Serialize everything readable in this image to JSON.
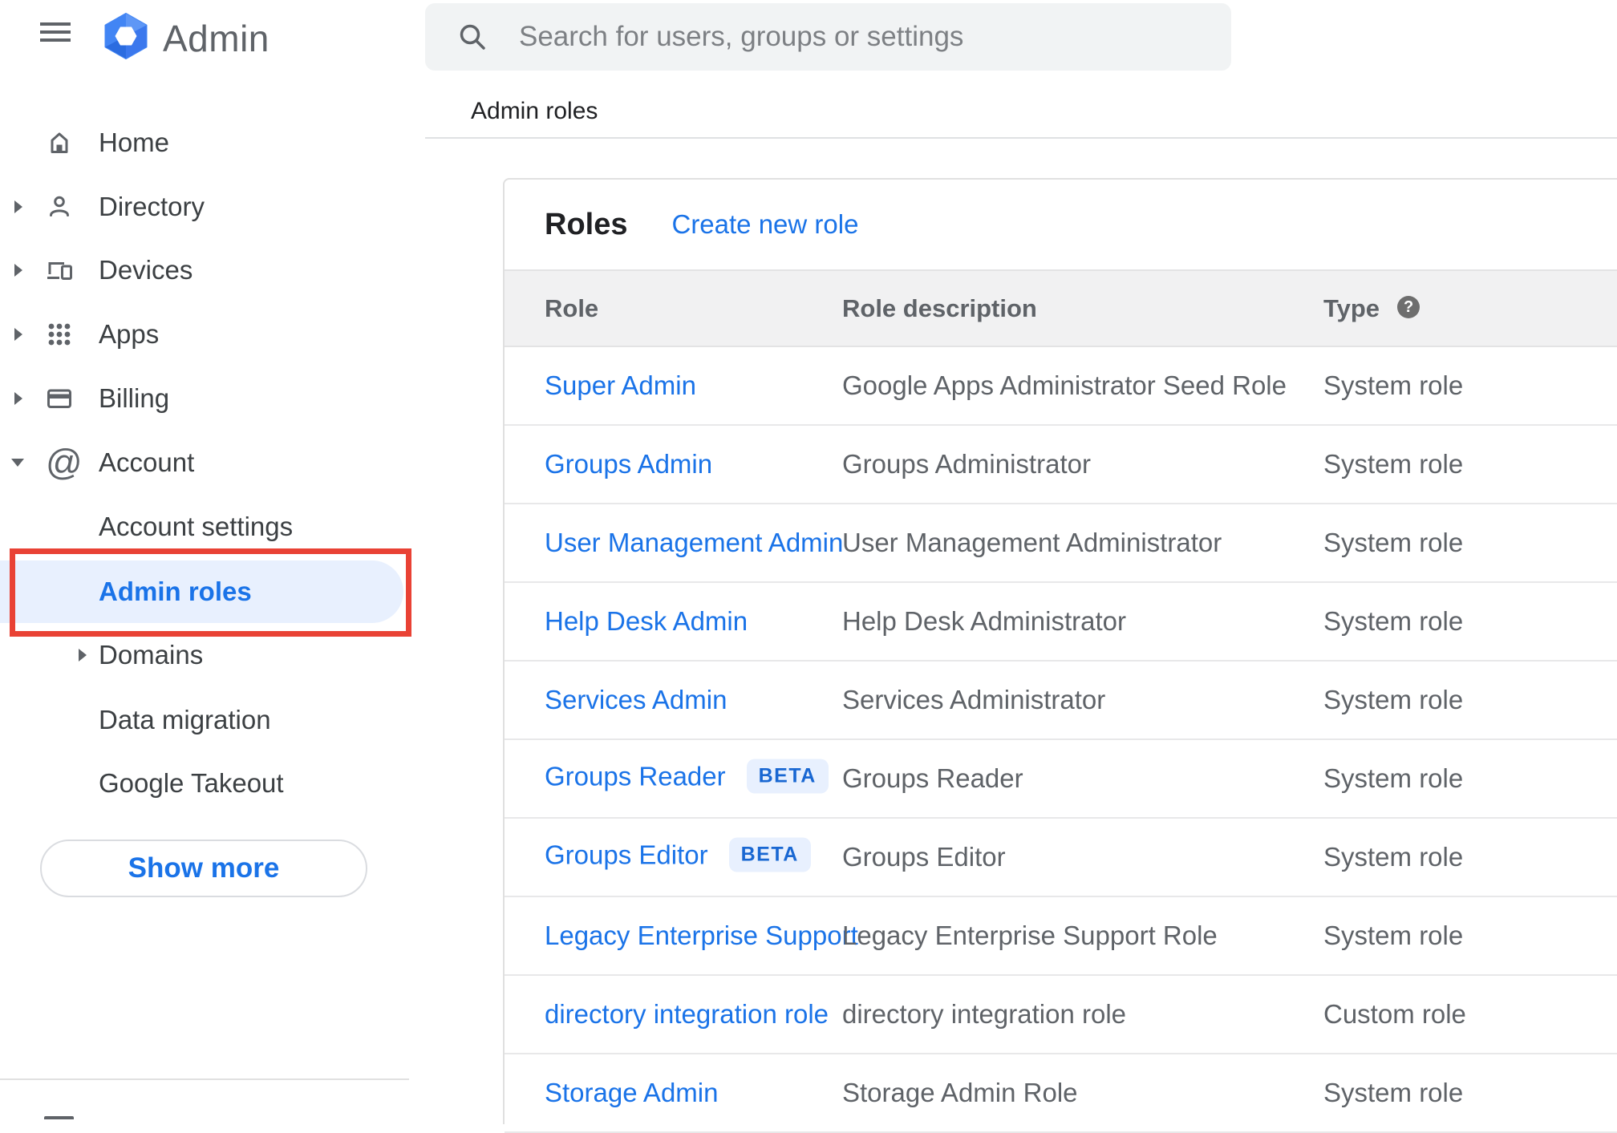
{
  "topbar": {
    "app_title": "Admin",
    "search_placeholder": "Search for users, groups or settings"
  },
  "breadcrumb": {
    "title": "Admin roles"
  },
  "sidebar": {
    "items": [
      {
        "label": "Home",
        "expandable": false
      },
      {
        "label": "Directory",
        "expandable": true
      },
      {
        "label": "Devices",
        "expandable": true
      },
      {
        "label": "Apps",
        "expandable": true
      },
      {
        "label": "Billing",
        "expandable": true
      },
      {
        "label": "Account",
        "expandable": true,
        "expanded": true
      }
    ],
    "account_children": [
      {
        "label": "Account settings"
      },
      {
        "label": "Admin roles",
        "active": true
      },
      {
        "label": "Domains",
        "expandable": true
      },
      {
        "label": "Data migration"
      },
      {
        "label": "Google Takeout"
      }
    ],
    "show_more_label": "Show more"
  },
  "roles_card": {
    "title": "Roles",
    "create_link": "Create new role",
    "columns": {
      "role": "Role",
      "description": "Role description",
      "type": "Type"
    },
    "help_icon_glyph": "?",
    "rows": [
      {
        "role": "Super Admin",
        "description": "Google Apps Administrator Seed Role",
        "type": "System role"
      },
      {
        "role": "Groups Admin",
        "description": "Groups Administrator",
        "type": "System role"
      },
      {
        "role": "User Management Admin",
        "description": "User Management Administrator",
        "type": "System role"
      },
      {
        "role": "Help Desk Admin",
        "description": "Help Desk Administrator",
        "type": "System role"
      },
      {
        "role": "Services Admin",
        "description": "Services Administrator",
        "type": "System role"
      },
      {
        "role": "Groups Reader",
        "badge": "BETA",
        "description": "Groups Reader",
        "type": "System role"
      },
      {
        "role": "Groups Editor",
        "badge": "BETA",
        "description": "Groups Editor",
        "type": "System role"
      },
      {
        "role": "Legacy Enterprise Support",
        "description": "Legacy Enterprise Support Role",
        "type": "System role"
      },
      {
        "role": "directory integration role",
        "description": "directory integration role",
        "type": "Custom role"
      },
      {
        "role": "Storage Admin",
        "description": "Storage Admin Role",
        "type": "System role"
      }
    ]
  },
  "colors": {
    "link_blue": "#1a73e8",
    "active_item_bg": "#e8f0fe",
    "beta_badge_bg": "#e8f0fe",
    "beta_badge_text": "#1967d2",
    "annotation_red": "#e94235",
    "table_header_bg": "#f1f1f2",
    "divider": "#e0e0e0",
    "icon_gray": "#5f6368",
    "text_dark": "#202124",
    "search_bg": "#f1f3f4",
    "logo_blue": "#4285f4"
  }
}
